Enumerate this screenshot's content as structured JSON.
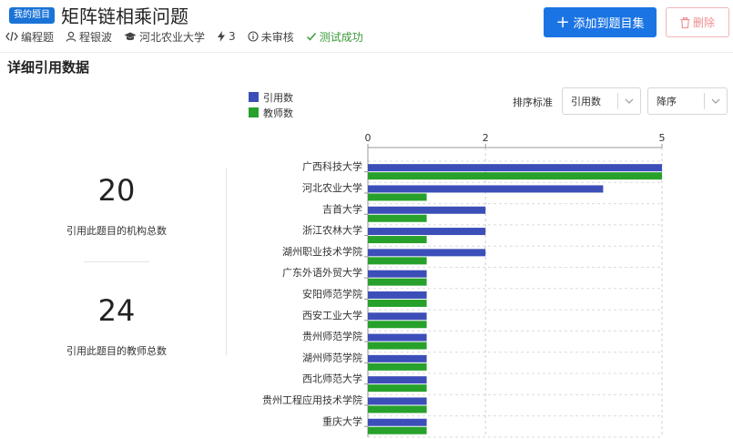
{
  "header": {
    "tag": "我的题目",
    "title": "矩阵链相乘问题",
    "meta": {
      "type": "编程题",
      "author": "程银波",
      "school": "河北农业大学",
      "count": "3",
      "review": "未审核",
      "status": "测试成功"
    },
    "add_button": "添加到题目集",
    "delete_button": "删除"
  },
  "section": {
    "title": "详细引用数据"
  },
  "summary": {
    "institutions": {
      "value": "20",
      "label": "引用此题目的机构总数"
    },
    "teachers": {
      "value": "24",
      "label": "引用此题目的教师总数"
    }
  },
  "sort": {
    "label": "排序标准",
    "field": "引用数",
    "order": "降序"
  },
  "colors": {
    "series1": "#3c4fb8",
    "series2": "#27a12b",
    "primary": "#1b74e4"
  },
  "chart_data": {
    "type": "bar",
    "orientation": "horizontal",
    "categories": [
      "广西科技大学",
      "河北农业大学",
      "吉首大学",
      "浙江农林大学",
      "湖州职业技术学院",
      "广东外语外贸大学",
      "安阳师范学院",
      "西安工业大学",
      "贵州师范学院",
      "湖州师范学院",
      "西北师范大学",
      "贵州工程应用技术学院",
      "重庆大学"
    ],
    "series": [
      {
        "name": "引用数",
        "values": [
          5,
          4,
          2,
          2,
          2,
          1,
          1,
          1,
          1,
          1,
          1,
          1,
          1
        ]
      },
      {
        "name": "教师数",
        "values": [
          5,
          1,
          1,
          1,
          1,
          1,
          1,
          1,
          1,
          1,
          1,
          1,
          1
        ]
      }
    ],
    "xticks": [
      "0",
      "2",
      "5"
    ],
    "xlim": [
      0,
      5
    ],
    "grid": true,
    "legend_position": "top"
  }
}
